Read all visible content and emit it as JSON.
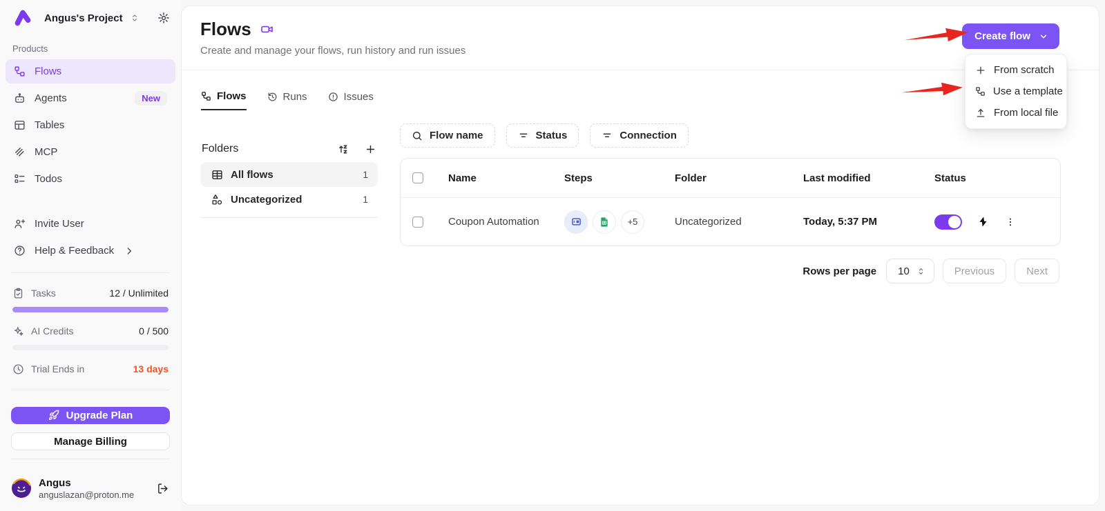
{
  "colors": {
    "primary_purple": "#7c54f3",
    "active_nav_purple": "#7c3aed",
    "active_nav_bg": "#ece7fc",
    "progress_purple": "#a78bfa",
    "trial_warning": "#f4511e",
    "annotation_red": "#e8251f",
    "sheets_green": "#23a566"
  },
  "sidebar": {
    "project_name": "Angus's Project",
    "products_label": "Products",
    "items": [
      {
        "label": "Flows",
        "icon": "workflow-icon",
        "active": true
      },
      {
        "label": "Agents",
        "icon": "bot-icon",
        "badge": "New"
      },
      {
        "label": "Tables",
        "icon": "table-icon"
      },
      {
        "label": "MCP",
        "icon": "mcp-icon"
      },
      {
        "label": "Todos",
        "icon": "todos-icon"
      }
    ],
    "secondary": [
      {
        "label": "Invite User",
        "icon": "user-plus-icon"
      },
      {
        "label": "Help & Feedback",
        "icon": "help-circle-icon"
      }
    ],
    "usage": {
      "tasks_label": "Tasks",
      "tasks_value": "12 / Unlimited",
      "tasks_percent": 100,
      "credits_label": "AI Credits",
      "credits_value": "0 / 500",
      "credits_percent": 0,
      "trial_label": "Trial Ends in",
      "trial_value": "13 days"
    },
    "upgrade_label": "Upgrade Plan",
    "billing_label": "Manage Billing",
    "user": {
      "name": "Angus",
      "email": "anguslazan@proton.me"
    }
  },
  "header": {
    "title": "Flows",
    "subtitle": "Create and manage your flows, run history and run issues",
    "create_button_label": "Create flow"
  },
  "tabs": [
    {
      "label": "Flows",
      "icon": "workflow-icon",
      "active": true
    },
    {
      "label": "Runs",
      "icon": "history-icon"
    },
    {
      "label": "Issues",
      "icon": "alert-circle-icon"
    }
  ],
  "folders": {
    "title": "Folders",
    "icons": [
      "sort-az-icon",
      "plus-icon"
    ],
    "items": [
      {
        "label": "All flows",
        "icon": "grid-icon",
        "count": "1",
        "active": true
      },
      {
        "label": "Uncategorized",
        "icon": "shapes-icon",
        "count": "1"
      }
    ]
  },
  "filters": [
    {
      "label": "Flow name",
      "icon": "search-icon"
    },
    {
      "label": "Status",
      "icon": "filter-icon"
    },
    {
      "label": "Connection",
      "icon": "filter-icon"
    }
  ],
  "table": {
    "columns": {
      "name": "Name",
      "steps": "Steps",
      "folder": "Folder",
      "last_modified": "Last modified",
      "status": "Status"
    },
    "rows": [
      {
        "name": "Coupon Automation",
        "step_icons": [
          "forms-piece-icon",
          "google-sheets-icon"
        ],
        "steps_more": "+5",
        "folder": "Uncategorized",
        "last_modified": "Today, 5:37 PM",
        "enabled": true
      }
    ]
  },
  "pagination": {
    "rows_per_page_label": "Rows per page",
    "rows_per_page_value": "10",
    "previous_label": "Previous",
    "next_label": "Next"
  },
  "create_menu": {
    "items": [
      {
        "label": "From scratch",
        "icon": "plus-icon"
      },
      {
        "label": "Use a template",
        "icon": "workflow-icon"
      },
      {
        "label": "From local file",
        "icon": "upload-icon"
      }
    ]
  }
}
